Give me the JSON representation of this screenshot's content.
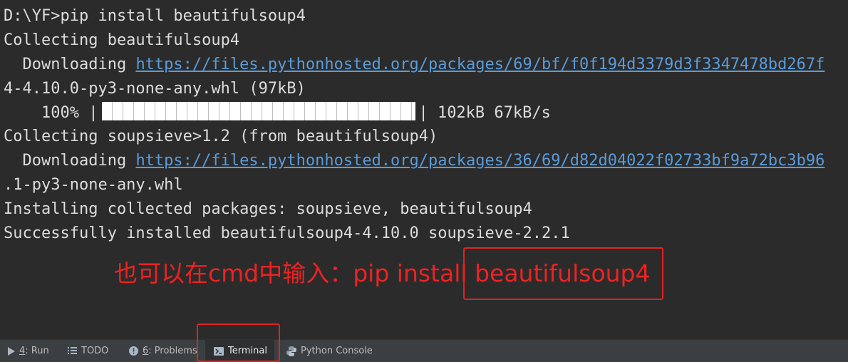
{
  "terminal": {
    "lines": [
      "D:\\YF>pip install beautifulsoup4",
      "Collecting beautifulsoup4",
      "  Downloading ",
      "4-4.10.0-py3-none-any.whl (97kB)",
      "    100% |",
      "Collecting soupsieve>1.2 (from beautifulsoup4)",
      "  Downloading ",
      ".1-py3-none-any.whl",
      "Installing collected packages: soupsieve, beautifulsoup4",
      "Successfully installed beautifulsoup4-4.10.0 soupsieve-2.2.1"
    ],
    "link1": "https://files.pythonhosted.org/packages/69/bf/f0f194d3379d3f3347478bd267f",
    "link2": "https://files.pythonhosted.org/packages/36/69/d82d04022f02733bf9a72bc3b96",
    "progress_after": "| 102kB 67kB/s",
    "progress_fraction": 1.0
  },
  "annotation": {
    "text_prefix": "也可以在cmd中输入：pip install ",
    "text_highlight": "beautifulsoup4",
    "color": "#ee2222"
  },
  "statusbar": {
    "tools": [
      {
        "icon": "play-icon",
        "key": "4",
        "label": ": Run"
      },
      {
        "icon": "list-icon",
        "label": "TODO"
      },
      {
        "icon": "warning-icon",
        "key": "6",
        "label": ": Problems"
      },
      {
        "icon": "terminal-icon",
        "label": "Terminal",
        "active": true
      },
      {
        "icon": "python-icon",
        "label": "Python Console"
      }
    ]
  }
}
